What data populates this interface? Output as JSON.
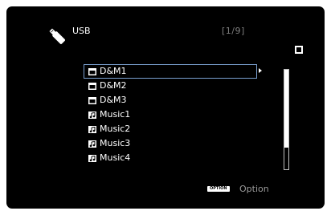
{
  "header": {
    "usb_icon": "usb-stick-icon",
    "source_title": "USB",
    "page_counter": "[1/9]"
  },
  "list": {
    "items": [
      {
        "label": "D&M1",
        "icon": "folder-icon",
        "selected": true
      },
      {
        "label": "D&M2",
        "icon": "folder-icon",
        "selected": false
      },
      {
        "label": "D&M3",
        "icon": "folder-icon",
        "selected": false
      },
      {
        "label": "Music1",
        "icon": "music-file-icon",
        "selected": false
      },
      {
        "label": "Music2",
        "icon": "music-file-icon",
        "selected": false
      },
      {
        "label": "Music3",
        "icon": "music-file-icon",
        "selected": false
      },
      {
        "label": "Music4",
        "icon": "music-file-icon",
        "selected": false
      }
    ]
  },
  "scroll": {
    "position_fraction": 0.78
  },
  "footer": {
    "option_badge": "OPTION",
    "option_label": "Option"
  },
  "colors": {
    "background": "#000000",
    "text": "#ffffff",
    "dim_text": "#7f7f7f",
    "selection_outline": "#7aa0d0"
  }
}
